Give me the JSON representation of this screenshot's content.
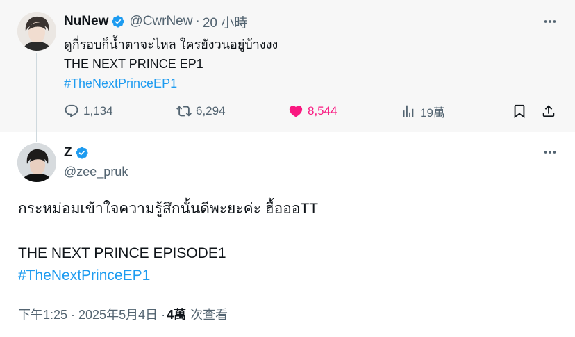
{
  "parent_tweet": {
    "author_name": "NuNew",
    "handle": "@CwrNew",
    "separator": "·",
    "time": "20 小時",
    "lines": [
      "ดูกี่รอบก็น้ำตาจะไหล ใครยังวนอยู่บ้างงง",
      "THE NEXT PRINCE EP1"
    ],
    "hashtag": "#TheNextPrinceEP1",
    "stats": {
      "replies": "1,134",
      "retweets": "6,294",
      "likes": "8,544",
      "views": "19萬"
    }
  },
  "main_tweet": {
    "author_name": "Z",
    "handle": "@zee_pruk",
    "lines": [
      "กระหม่อมเข้าใจความรู้สึกนั้นดีพะยะค่ะ ฮื้อออTT",
      "",
      "THE NEXT PRINCE EPISODE1"
    ],
    "hashtag": "#TheNextPrinceEP1",
    "timestamp": "下午1:25 · 2025年5月4日 · ",
    "views_count": "4萬",
    "views_label": "次查看"
  },
  "colors": {
    "accent": "#1d9bf0",
    "like": "#f91880",
    "secondary_text": "#536471",
    "parent_bg": "#f7f7f7"
  },
  "icons": [
    "verified-badge-icon",
    "more-icon",
    "reply-icon",
    "retweet-icon",
    "heart-icon",
    "views-icon",
    "bookmark-icon",
    "share-icon"
  ]
}
